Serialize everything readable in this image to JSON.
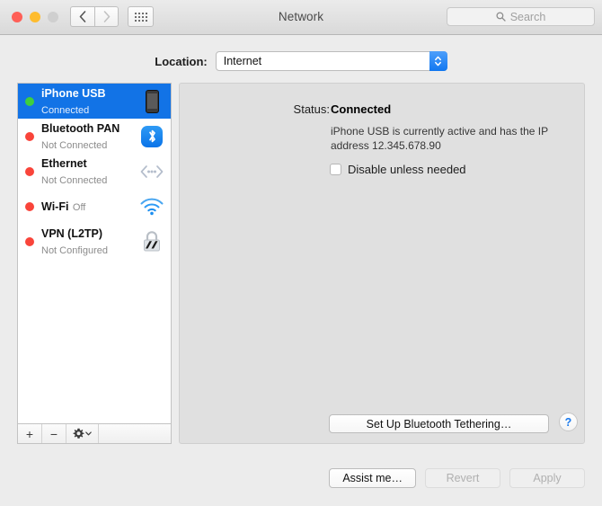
{
  "window": {
    "title": "Network",
    "traffic_lights": [
      "close",
      "minimize",
      "zoom"
    ],
    "nav": {
      "back_icon": "chevron-left-icon",
      "forward_icon": "chevron-right-icon"
    },
    "grid_button_icon": "show-all-grid-icon"
  },
  "search": {
    "placeholder": "Search",
    "icon": "search-icon"
  },
  "location": {
    "label": "Location:",
    "value": "Internet",
    "stepper_icon": "up-down-chevrons-icon"
  },
  "services": [
    {
      "name": "iPhone USB",
      "status": "Connected",
      "dot": "green",
      "icon": "iphone-icon",
      "selected": true
    },
    {
      "name": "Bluetooth PAN",
      "status": "Not Connected",
      "dot": "red",
      "icon": "bluetooth-icon",
      "selected": false
    },
    {
      "name": "Ethernet",
      "status": "Not Connected",
      "dot": "red",
      "icon": "ethernet-icon",
      "selected": false
    },
    {
      "name": "Wi-Fi",
      "status": "Off",
      "dot": "red",
      "icon": "wifi-icon",
      "selected": false
    },
    {
      "name": "VPN (L2TP)",
      "status": "Not Configured",
      "dot": "red",
      "icon": "lock-icon",
      "selected": false
    }
  ],
  "list_toolbar": {
    "add_label": "+",
    "remove_label": "−",
    "action_icon": "gear-icon",
    "action_chevron_icon": "chevron-down-icon"
  },
  "detail": {
    "status_label": "Status:",
    "status_value": "Connected",
    "description": "iPhone USB is currently active and has the IP address 12.345.678.90",
    "checkbox_label": "Disable unless needed",
    "checkbox_checked": false,
    "tethering_button": "Set Up Bluetooth Tethering…",
    "help_button": "?"
  },
  "footer": {
    "assist_label": "Assist me…",
    "revert_label": "Revert",
    "apply_label": "Apply",
    "revert_disabled": true,
    "apply_disabled": true
  },
  "colors": {
    "selection_blue": "#1273e6",
    "accent_blue": "#1a7aee",
    "status_green": "#3ecf3e",
    "status_red": "#f9443a",
    "window_bg": "#ececec",
    "panel_bg": "#e0e0e0"
  }
}
